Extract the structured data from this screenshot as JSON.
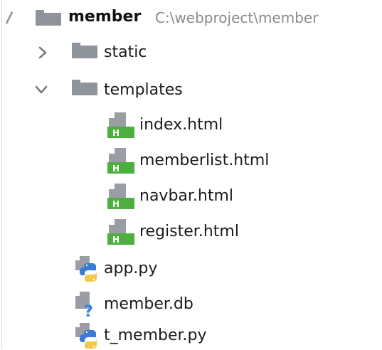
{
  "project_tree": {
    "root": {
      "name": "member",
      "path": "C:\\webproject\\member",
      "icon": "folder-icon",
      "expanded": true
    },
    "items": [
      {
        "name": "static",
        "icon": "folder-icon",
        "kind": "folder",
        "expanded": false
      },
      {
        "name": "templates",
        "icon": "folder-icon",
        "kind": "folder",
        "expanded": true
      },
      {
        "name": "index.html",
        "icon": "html-file-icon",
        "kind": "file"
      },
      {
        "name": "memberlist.html",
        "icon": "html-file-icon",
        "kind": "file"
      },
      {
        "name": "navbar.html",
        "icon": "html-file-icon",
        "kind": "file"
      },
      {
        "name": "register.html",
        "icon": "html-file-icon",
        "kind": "file"
      },
      {
        "name": "app.py",
        "icon": "python-file-icon",
        "kind": "file"
      },
      {
        "name": "member.db",
        "icon": "unknown-file-icon",
        "kind": "file"
      },
      {
        "name": "t_member.py",
        "icon": "python-file-icon",
        "kind": "file"
      }
    ],
    "colors": {
      "folder": "#8f939a",
      "html_badge": "#4caf3f",
      "python_blue": "#3a7bd5",
      "python_yellow": "#f2c94c",
      "unknown_blue": "#2f80ed",
      "path_text": "#8a8a8a"
    }
  }
}
